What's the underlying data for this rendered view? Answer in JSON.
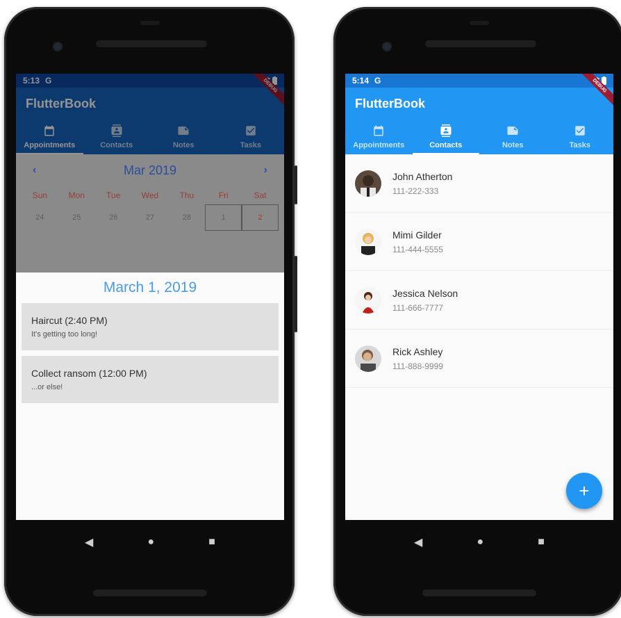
{
  "left_phone": {
    "status": {
      "time": "5:13",
      "carrier": "G"
    },
    "debug_label": "DEBUG",
    "app_title": "FlutterBook",
    "tabs": [
      {
        "label": "Appointments",
        "icon": "calendar-icon",
        "active": true
      },
      {
        "label": "Contacts",
        "icon": "contacts-icon",
        "active": false
      },
      {
        "label": "Notes",
        "icon": "note-icon",
        "active": false
      },
      {
        "label": "Tasks",
        "icon": "checkbox-icon",
        "active": false
      }
    ],
    "calendar": {
      "month": "Mar 2019",
      "prev": "‹",
      "next": "›",
      "weekdays": [
        "Sun",
        "Mon",
        "Tue",
        "Wed",
        "Thu",
        "Fri",
        "Sat"
      ],
      "days": [
        "24",
        "25",
        "26",
        "27",
        "28",
        "1",
        "2"
      ]
    },
    "selected_date": "March 1, 2019",
    "appointments": [
      {
        "title": "Haircut (2:40 PM)",
        "description": "It's getting too long!"
      },
      {
        "title": "Collect ransom (12:00 PM)",
        "description": "...or else!"
      }
    ]
  },
  "right_phone": {
    "status": {
      "time": "5:14",
      "carrier": "G"
    },
    "debug_label": "DEBUG",
    "app_title": "FlutterBook",
    "tabs": [
      {
        "label": "Appointments",
        "icon": "calendar-icon",
        "active": false
      },
      {
        "label": "Contacts",
        "icon": "contacts-icon",
        "active": true
      },
      {
        "label": "Notes",
        "icon": "note-icon",
        "active": false
      },
      {
        "label": "Tasks",
        "icon": "checkbox-icon",
        "active": false
      }
    ],
    "contacts": [
      {
        "name": "John Atherton",
        "phone": "111-222-333"
      },
      {
        "name": "Mimi Gilder",
        "phone": "111-444-5555"
      },
      {
        "name": "Jessica Nelson",
        "phone": "111-666-7777"
      },
      {
        "name": "Rick Ashley",
        "phone": "111-888-9999"
      }
    ],
    "fab_label": "+"
  },
  "system_nav": {
    "back": "◀",
    "home": "●",
    "recents": "■"
  },
  "colors": {
    "primary": "#2196f3",
    "primary_dark": "#1976d2",
    "dimmed_primary": "#1565c0",
    "accent_date": "#4a9be8",
    "weekday_red": "#9a3b3b"
  }
}
